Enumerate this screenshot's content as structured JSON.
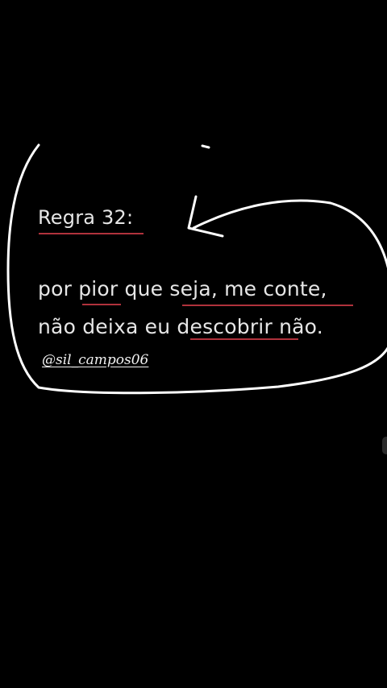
{
  "story": {
    "rule_title": "Regra 32:",
    "line1": "por pior que seja, me conte,",
    "line2": "não deixa eu descobrir não.",
    "handle": "@sil_campos06"
  },
  "colors": {
    "background": "#000000",
    "text": "#e6e6e6",
    "underline": "#b0323c",
    "ink": "#ffffff"
  }
}
